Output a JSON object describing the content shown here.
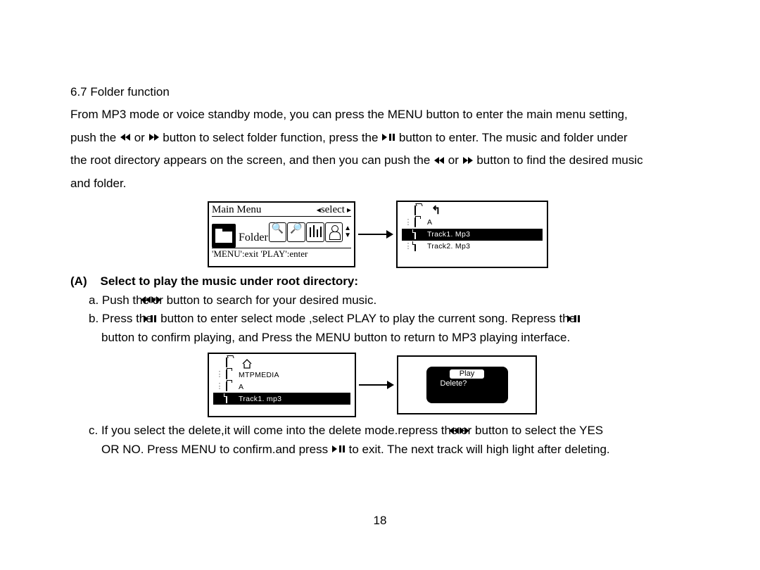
{
  "section": {
    "number": "6.7",
    "title": "Folder function"
  },
  "intro": {
    "l1a": "From MP3 mode or voice standby mode, you can press the MENU button to enter the main menu setting,",
    "l2a": "push the",
    "l2b": " or ",
    "l2c": " button to select folder function, press the ",
    "l2d": " button to enter. The music and folder under",
    "l3a": "the root directory appears on the screen, and then you can push the",
    "l3b": "or",
    "l3c": " button to find the desired music",
    "l4": "and folder."
  },
  "lcd1": {
    "title": "Main Menu",
    "select": "select",
    "folder": "Folder",
    "footer": "'MENU':exit 'PLAY':enter"
  },
  "fs1": {
    "up": "⬑",
    "a": "A",
    "t1": "Track1. Mp3",
    "t2": "Track2. Mp3"
  },
  "heading_A_prefix": "(A)",
  "heading_A": "Select to play the music under root directory:",
  "step_a_pre": "a. Push the ",
  "step_a_mid": "or",
  "step_a_post": " button to search for your desired music.",
  "step_b_pre": "b. Press the ",
  "step_b_mid": " button to enter select mode ,select PLAY to play the current song. Repress the ",
  "step_b_line2": "button to confirm playing, and Press the MENU button to return to MP3 playing interface.",
  "fs2": {
    "mtp": "MTPMEDIA",
    "a": "A",
    "t1": "Track1. mp3"
  },
  "popup": {
    "play": "Play",
    "delete": "Delete?"
  },
  "step_c_l1a": "c. If you select the delete,it will come into the delete mode.repress the ",
  "step_c_l1b": "or",
  "step_c_l1c": " button to select the YES",
  "step_c_l2a": "OR NO. Press MENU to confirm.and press",
  "step_c_l2b": " to exit. The next track will high light after deleting.",
  "page_number": "18"
}
